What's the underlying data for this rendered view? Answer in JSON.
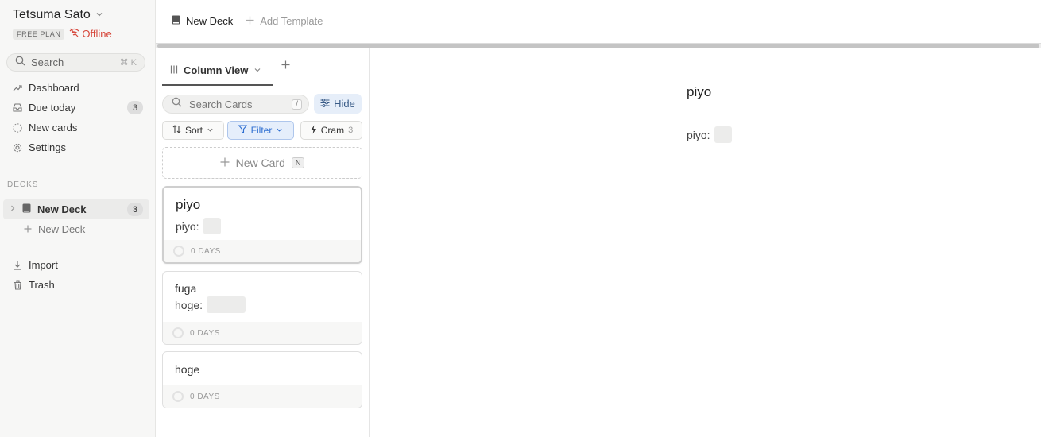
{
  "user": {
    "name": "Tetsuma Sato",
    "plan": "FREE PLAN",
    "status": "Offline"
  },
  "search": {
    "label": "Search",
    "shortcut": "⌘ K"
  },
  "nav": [
    {
      "label": "Dashboard",
      "icon": "trend-icon"
    },
    {
      "label": "Due today",
      "icon": "inbox-icon",
      "count": "3"
    },
    {
      "label": "New cards",
      "icon": "dashed-circle-icon"
    },
    {
      "label": "Settings",
      "icon": "gear-icon"
    }
  ],
  "decks": {
    "section_label": "DECKS",
    "items": [
      {
        "label": "New Deck",
        "count": "3"
      }
    ],
    "add_label": "New Deck"
  },
  "nav2": [
    {
      "label": "Import",
      "icon": "download-icon"
    },
    {
      "label": "Trash",
      "icon": "trash-icon"
    }
  ],
  "topbar": {
    "deck_tab": "New Deck",
    "add_template": "Add Template"
  },
  "column": {
    "view_label": "Column View",
    "search_placeholder": "Search Cards",
    "search_shortcut": "/",
    "hide_label": "Hide",
    "sort_label": "Sort",
    "filter_label": "Filter",
    "cram_label": "Cram",
    "cram_count": "3",
    "new_card_label": "New Card",
    "new_card_shortcut": "N"
  },
  "cards": [
    {
      "title": "piyo",
      "field_label": "piyo:",
      "due": "0 DAYS",
      "selected": true
    },
    {
      "title": "fuga",
      "field_label": "hoge:",
      "due": "0 DAYS"
    },
    {
      "title": "hoge",
      "due": "0 DAYS"
    }
  ],
  "detail": {
    "title": "piyo",
    "field_label": "piyo:"
  },
  "colors": {
    "accent": "#2f6fd1",
    "offline": "#d6473b",
    "hide_bg": "#e6eef9"
  }
}
